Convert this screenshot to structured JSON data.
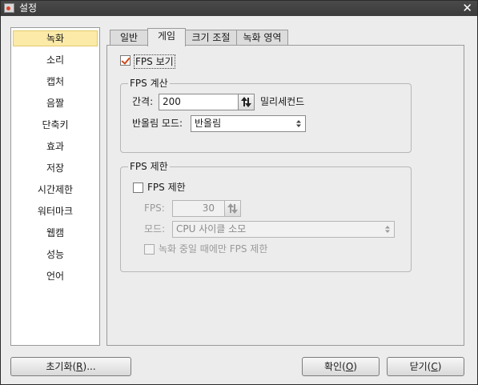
{
  "window": {
    "title": "설정",
    "close_glyph": "✕"
  },
  "sidebar": {
    "selected_index": 0,
    "items": [
      "녹화",
      "소리",
      "캡처",
      "음짤",
      "단축키",
      "효과",
      "저장",
      "시간제한",
      "워터마크",
      "웹캠",
      "성능",
      "언어"
    ]
  },
  "tabs": [
    {
      "label": "일반",
      "active": false
    },
    {
      "label": "게임",
      "active": true
    },
    {
      "label": "크기 조절",
      "active": false
    },
    {
      "label": "녹화 영역",
      "active": false
    }
  ],
  "game": {
    "show_fps": {
      "label": "FPS 보기",
      "checked": true
    },
    "fps_calc": {
      "legend": "FPS 계산",
      "interval_label": "간격:",
      "interval_value": "200",
      "interval_unit": "밀리세컨드",
      "rounding_label": "반올림 모드:",
      "rounding_value": "반올림"
    },
    "fps_limit": {
      "legend": "FPS 제한",
      "enable": {
        "label": "FPS 제한",
        "checked": false
      },
      "fps_label": "FPS:",
      "fps_value": "30",
      "mode_label": "모드:",
      "mode_value": "CPU 사이클 소모",
      "rec_only": {
        "label": "녹화 중일 때에만 FPS 제한",
        "checked": false
      }
    }
  },
  "footer": {
    "reset": {
      "text": "초기화(",
      "key": "R",
      "tail": ")..."
    },
    "ok": {
      "text": "확인(",
      "key": "O",
      "tail": ")"
    },
    "close": {
      "text": "닫기(",
      "key": "C",
      "tail": ")"
    }
  },
  "colors": {
    "accent_check": "#d0481c",
    "selected_item_bg": "#fbeaa8",
    "titlebar": "#3b3b3b"
  },
  "icons": {
    "app": "app-icon",
    "close": "close-icon",
    "spin": "spin-arrows-icon",
    "combo": "combo-arrows-icon"
  }
}
